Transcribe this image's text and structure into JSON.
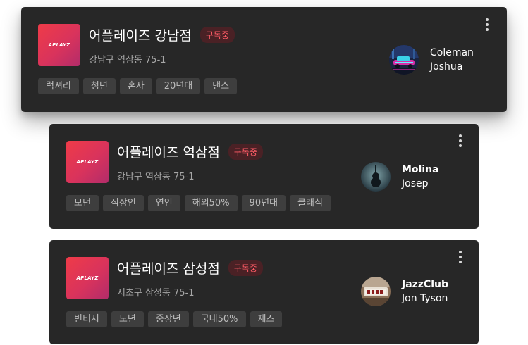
{
  "brand": {
    "logo_text": "APLAYZ"
  },
  "colors": {
    "card_bg": "#272727",
    "badge_text": "#ff5c66",
    "logo_gradient_start": "#ef3b48",
    "logo_gradient_end": "#b22c6a"
  },
  "stores": [
    {
      "name": "어플레이즈 강남점",
      "badge": "구독중",
      "address": "강남구 역삼동 75-1",
      "tags": [
        "럭셔리",
        "청년",
        "혼자",
        "20년대",
        "댄스"
      ],
      "artist": {
        "first": "Coleman",
        "last": "Joshua",
        "avatar_icon": "neon-car-avatar"
      }
    },
    {
      "name": "어플레이즈 역삼점",
      "badge": "구독중",
      "address": "강남구 역삼동 75-1",
      "tags": [
        "모던",
        "직장인",
        "연인",
        "해외50%",
        "90년대",
        "클래식"
      ],
      "artist": {
        "first": "Molina",
        "last": "Josep",
        "avatar_icon": "violin-avatar"
      }
    },
    {
      "name": "어플레이즈 삼성점",
      "badge": "구독중",
      "address": "서초구 삼성동 75-1",
      "tags": [
        "빈티지",
        "노년",
        "중장년",
        "국내50%",
        "재즈"
      ],
      "artist": {
        "first": "JazzClub",
        "last": "Jon Tyson",
        "avatar_icon": "jazz-club-sign-avatar"
      }
    }
  ]
}
